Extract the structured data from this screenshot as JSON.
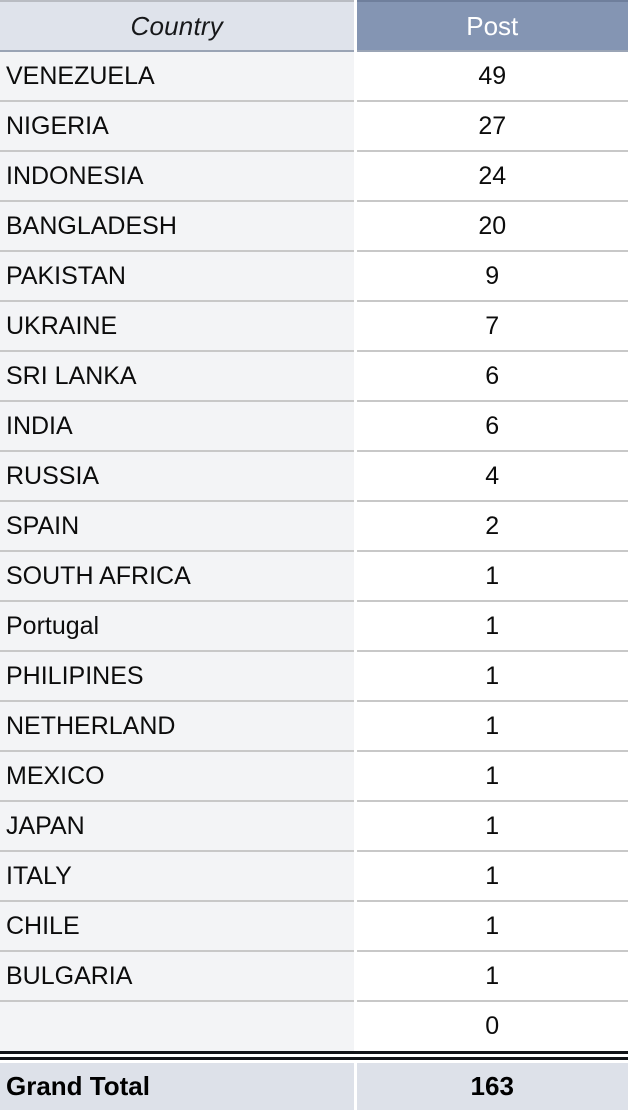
{
  "table": {
    "columns": [
      {
        "key": "country",
        "label": "Country",
        "align": "center",
        "style": "italic"
      },
      {
        "key": "post",
        "label": "Post",
        "align": "center",
        "style": "normal"
      }
    ],
    "rows": [
      {
        "country": "VENEZUELA",
        "post": "49"
      },
      {
        "country": "NIGERIA",
        "post": "27"
      },
      {
        "country": "INDONESIA",
        "post": "24"
      },
      {
        "country": "BANGLADESH",
        "post": "20"
      },
      {
        "country": "PAKISTAN",
        "post": "9"
      },
      {
        "country": "UKRAINE",
        "post": "7"
      },
      {
        "country": "SRI LANKA",
        "post": "6"
      },
      {
        "country": "INDIA",
        "post": "6"
      },
      {
        "country": "RUSSIA",
        "post": "4"
      },
      {
        "country": "SPAIN",
        "post": "2"
      },
      {
        "country": "SOUTH AFRICA",
        "post": "1"
      },
      {
        "country": "Portugal",
        "post": "1"
      },
      {
        "country": "PHILIPINES",
        "post": "1"
      },
      {
        "country": "NETHERLAND",
        "post": "1"
      },
      {
        "country": "MEXICO",
        "post": "1"
      },
      {
        "country": "JAPAN",
        "post": "1"
      },
      {
        "country": "ITALY",
        "post": "1"
      },
      {
        "country": "CHILE",
        "post": "1"
      },
      {
        "country": "BULGARIA",
        "post": "1"
      },
      {
        "country": "",
        "post": "0"
      }
    ],
    "total": {
      "label": "Grand Total",
      "post": "163"
    }
  },
  "chart_data": {
    "type": "table",
    "title": "",
    "columns": [
      "Country",
      "Post"
    ],
    "categories": [
      "VENEZUELA",
      "NIGERIA",
      "INDONESIA",
      "BANGLADESH",
      "PAKISTAN",
      "UKRAINE",
      "SRI LANKA",
      "INDIA",
      "RUSSIA",
      "SPAIN",
      "SOUTH AFRICA",
      "Portugal",
      "PHILIPINES",
      "NETHERLAND",
      "MEXICO",
      "JAPAN",
      "ITALY",
      "CHILE",
      "BULGARIA",
      ""
    ],
    "values": [
      49,
      27,
      24,
      20,
      9,
      7,
      6,
      6,
      4,
      2,
      1,
      1,
      1,
      1,
      1,
      1,
      1,
      1,
      1,
      0
    ],
    "total": 163,
    "ylabel": "Post",
    "xlabel": "Country"
  },
  "colors": {
    "header_country_bg": "#dfe3eb",
    "header_post_bg": "#8495b3",
    "header_post_text": "#ffffff",
    "body_country_bg": "#f3f4f6",
    "body_post_bg": "#ffffff",
    "row_divider": "#c8c8c8",
    "total_bg": "#dde1e9",
    "total_rule": "#111418",
    "text": "#0c0c0c"
  }
}
